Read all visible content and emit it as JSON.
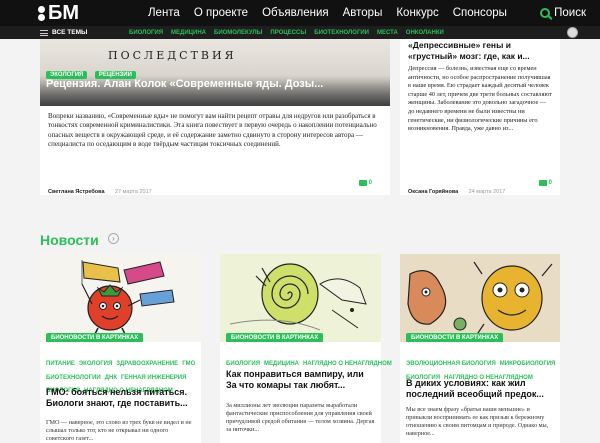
{
  "header": {
    "logo": "БМ",
    "nav": [
      "Лента",
      "О проекте",
      "Объявления",
      "Авторы",
      "Конкурс",
      "Спонсоры"
    ],
    "search_label": "Поиск"
  },
  "subheader": {
    "all_themes": "ВСЕ ТЕМЫ",
    "themes": [
      "БИОЛОГИЯ",
      "МЕДИЦИНА",
      "БИОМОЛЕКУЛЫ",
      "ПРОЦЕССЫ",
      "БИОТЕХНОЛОГИИ",
      "МЕСТА",
      "ОНКОЛАНКИ"
    ]
  },
  "featured": {
    "image_caption": "ПОСЛЕДСТВИЯ",
    "tags": [
      "ЭКОЛОГИЯ",
      "РЕЦЕНЗИИ"
    ],
    "title": "Рецензия. Алан Колок «Современные яды. Дозы...",
    "excerpt": "Вопреки названию, «Современные яды» не помогут вам найти рецепт отравы для недругов или разобраться в тонкостях современной криминалистики. Эта книга повествует в первую очередь о накоплении потенциально опасных веществ в окружающей среде, и её содержание заметно сдвинуто в сторону интересов автора — специалиста по оседающим в воде твёрдым частицам токсичных соединений.",
    "author": "Светлана Ястребова",
    "date": "27 марта 2017",
    "comments": "0"
  },
  "side_article": {
    "title": "«Депрессивные» гены и «грустный» мозг: где, как и...",
    "excerpt": "Депрессия — болезнь, известная еще со времен античности, но особое распространение получившая в наше время. Ею страдает каждый десятый человек старше 40 лет, причем две трети больных составляют женщины. Заболевание это довольно загадочное — до недавнего времени не были известны ни генетические, ни физиологические причины его возникновения. Правда, уже давно из...",
    "author": "Оксана Горяйнова",
    "date": "24 марта 2017",
    "comments": "0"
  },
  "news": {
    "title": "Новости",
    "items": [
      {
        "pill": "БИОНОВОСТИ В КАРТИНКАХ",
        "tags": [
          "ПИТАНИЕ",
          "ЭКОЛОГИЯ",
          "ЗДРАВООХРАНЕНИЕ",
          "ГМО",
          "БИОТЕХНОЛОГИИ",
          "ДНК",
          "ГЕННАЯ ИНЖЕНЕРИЯ",
          "БИОЛОГИЯ",
          "НАГЛЯДНО О НЕНАГЛЯДНОМ"
        ],
        "title": "ГМО: бояться нельзя питаться. Биологи знают, где поставить...",
        "text": "ГМО — наверное, это слово из трех букв не видел и не слышал только тот, кто не открывал ни одного советского газет..."
      },
      {
        "pill": "БИОНОВОСТИ В КАРТИНКАХ",
        "tags": [
          "БИОЛОГИЯ",
          "МЕДИЦИНА",
          "НАГЛЯДНО О НЕНАГЛЯДНОМ"
        ],
        "title": "Как понравиться вампиру, или За что комары так любят...",
        "text": "За миллионы лет эволюции паразиты выработали фантастические приспособления для управления своей причудливой средой обитания — телом хозяина. Дергая за ниточки..."
      },
      {
        "pill": "БИОНОВОСТИ В КАРТИНКАХ",
        "tags": [
          "ЭВОЛЮЦИОННАЯ БИОЛОГИЯ",
          "МИКРОБИОЛОГИЯ",
          "БИОЛОГИЯ",
          "НАГЛЯДНО О НЕНАГЛЯДНОМ"
        ],
        "title": "В диких условиях: как жил последний всеобщий предок...",
        "text": "Мы все знаем фразу «братья наши меньшие» и привыкли воспринимать ее как призыв к бережному отношению к своим питомцам и природе. Однако мы, наверное..."
      }
    ]
  }
}
